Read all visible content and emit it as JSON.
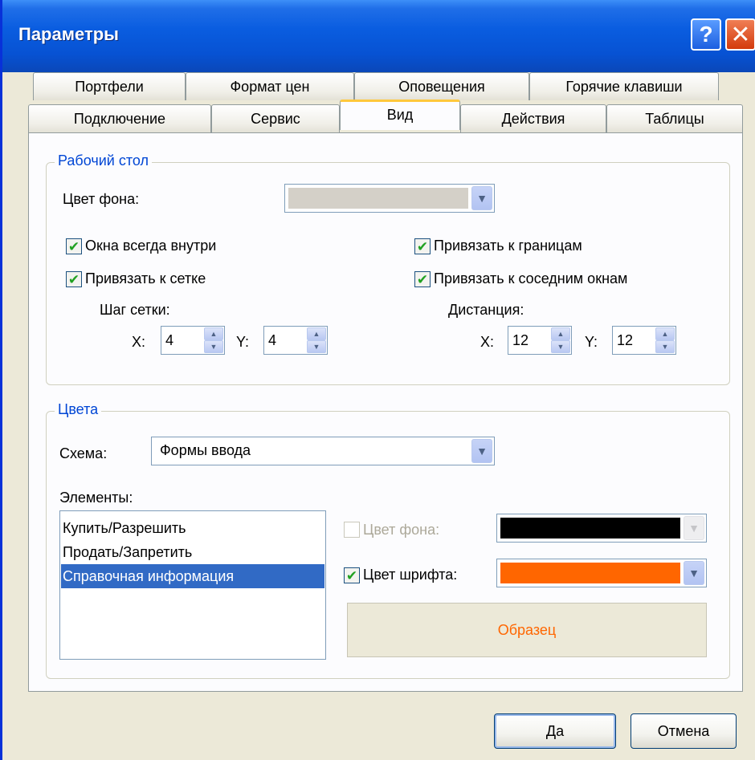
{
  "window": {
    "title": "Параметры",
    "help_glyph": "?",
    "close_glyph": "✕"
  },
  "tabs_back": [
    "Портфели",
    "Формат цен",
    "Оповещения",
    "Горячие клавиши"
  ],
  "tabs_front": [
    "Подключение",
    "Сервис",
    "Вид",
    "Действия",
    "Таблицы"
  ],
  "active_tab": "Вид",
  "desktop": {
    "title": "Рабочий стол",
    "bg_label": "Цвет фона:",
    "bg_color": "#d4d0c8",
    "always_inside": {
      "label": "Окна всегда внутри",
      "checked": true
    },
    "snap_grid": {
      "label": "Привязать к сетке",
      "checked": true
    },
    "snap_borders": {
      "label": "Привязать к границам",
      "checked": true
    },
    "snap_windows": {
      "label": "Привязать к соседним окнам",
      "checked": true
    },
    "grid_step_label": "Шаг сетки:",
    "distance_label": "Дистанция:",
    "x_label": "X:",
    "y_label": "Y:",
    "grid_x": "4",
    "grid_y": "4",
    "dist_x": "12",
    "dist_y": "12"
  },
  "colors": {
    "title": "Цвета",
    "scheme_label": "Схема:",
    "scheme_value": "Формы ввода",
    "elements_label": "Элементы:",
    "elements": [
      "Купить/Разрешить",
      "Продать/Запретить",
      "Справочная информация"
    ],
    "selected_index": 2,
    "bg_color_label": "Цвет фона:",
    "bg_color_checked": false,
    "bg_color_value": "#000000",
    "font_color_label": "Цвет шрифта:",
    "font_color_checked": true,
    "font_color_value": "#ff6600",
    "sample_label": "Образец"
  },
  "buttons": {
    "ok": "Да",
    "cancel": "Отмена"
  },
  "icons": {
    "dropdown": "chevron-down-icon",
    "spin_up": "arrow-up-icon",
    "spin_down": "arrow-down-icon",
    "check": "checkmark-icon"
  }
}
